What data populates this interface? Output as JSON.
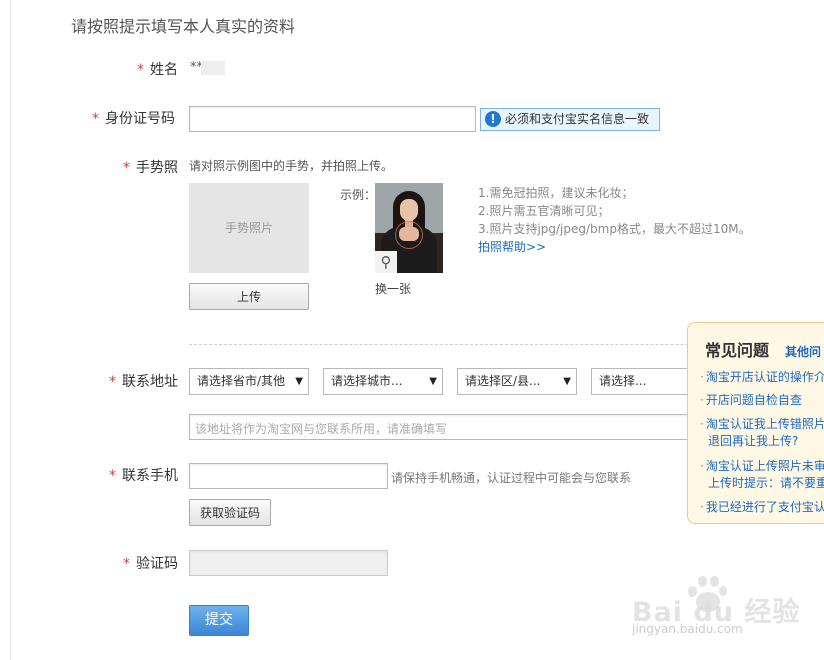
{
  "heading": "请按照提示填写本人真实的资料",
  "form": {
    "required_mark": "*",
    "name": {
      "label": "姓名",
      "value": "**"
    },
    "id_number": {
      "label": "身份证号码",
      "value": "",
      "tip": "必须和支付宝实名信息一致"
    },
    "gesture_photo": {
      "label": "手势照",
      "hint": "请对照示例图中的手势，并拍照上传。",
      "placeholder": "手势照片",
      "upload_button": "上传",
      "example_label": "示例：",
      "swap_link": "换一张",
      "notes": [
        "1.需免冠拍照，建议未化妆；",
        "2.照片需五官清晰可见；",
        "3.照片支持jpg/jpeg/bmp格式，最大不超过10M。"
      ],
      "help_link": "拍照帮助>>"
    },
    "address": {
      "label": "联系地址",
      "selects": [
        "请选择省市/其他",
        "请选择城市...",
        "请选择区/县...",
        "请选择..."
      ],
      "detail_placeholder": "该地址将作为淘宝网与您联系所用，请准确填写"
    },
    "phone": {
      "label": "联系手机",
      "value": "",
      "hint": "请保持手机畅通，认证过程中可能会与您联系",
      "get_code_button": "获取验证码"
    },
    "verify_code": {
      "label": "验证码",
      "value": ""
    },
    "submit_button": "提交"
  },
  "faq": {
    "title": "常见问题",
    "more": "其他问",
    "bullet": "·",
    "items": [
      "淘宝开店认证的操作介",
      "开店问题自检自查",
      "淘宝认证我上传错照片",
      "退回再让我上传?",
      "淘宝认证上传照片未审",
      "上传时提示：请不要重",
      "我已经进行了支付宝认"
    ]
  },
  "watermark": {
    "brand": "Bai du 经验",
    "url": "jingyan.baidu.com"
  }
}
